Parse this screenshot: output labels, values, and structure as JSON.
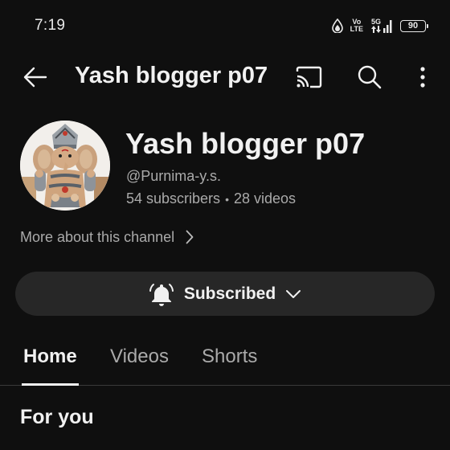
{
  "status_bar": {
    "time": "7:19",
    "network_top": "Vo",
    "network_bottom": "LTE",
    "signal_label": "5G",
    "battery": "90"
  },
  "header": {
    "title": "Yash blogger p07",
    "icons": [
      "back-arrow-icon",
      "cast-icon",
      "search-icon",
      "more-vert-icon"
    ]
  },
  "channel": {
    "name": "Yash blogger p07",
    "handle": "@Purnima-y.s.",
    "subscribers": "54 subscribers",
    "separator": "•",
    "videos": "28 videos",
    "more_about": "More about this channel"
  },
  "subscribe": {
    "label": "Subscribed",
    "icons": [
      "bell-icon",
      "chevron-down-icon"
    ]
  },
  "tabs": [
    {
      "label": "Home",
      "active": true
    },
    {
      "label": "Videos",
      "active": false
    },
    {
      "label": "Shorts",
      "active": false
    }
  ],
  "section": {
    "title": "For you"
  },
  "colors": {
    "background": "#0f0f0f",
    "button_bg": "#272727",
    "primary_text": "#f1f1f1",
    "secondary_text": "#aaaaaa"
  }
}
